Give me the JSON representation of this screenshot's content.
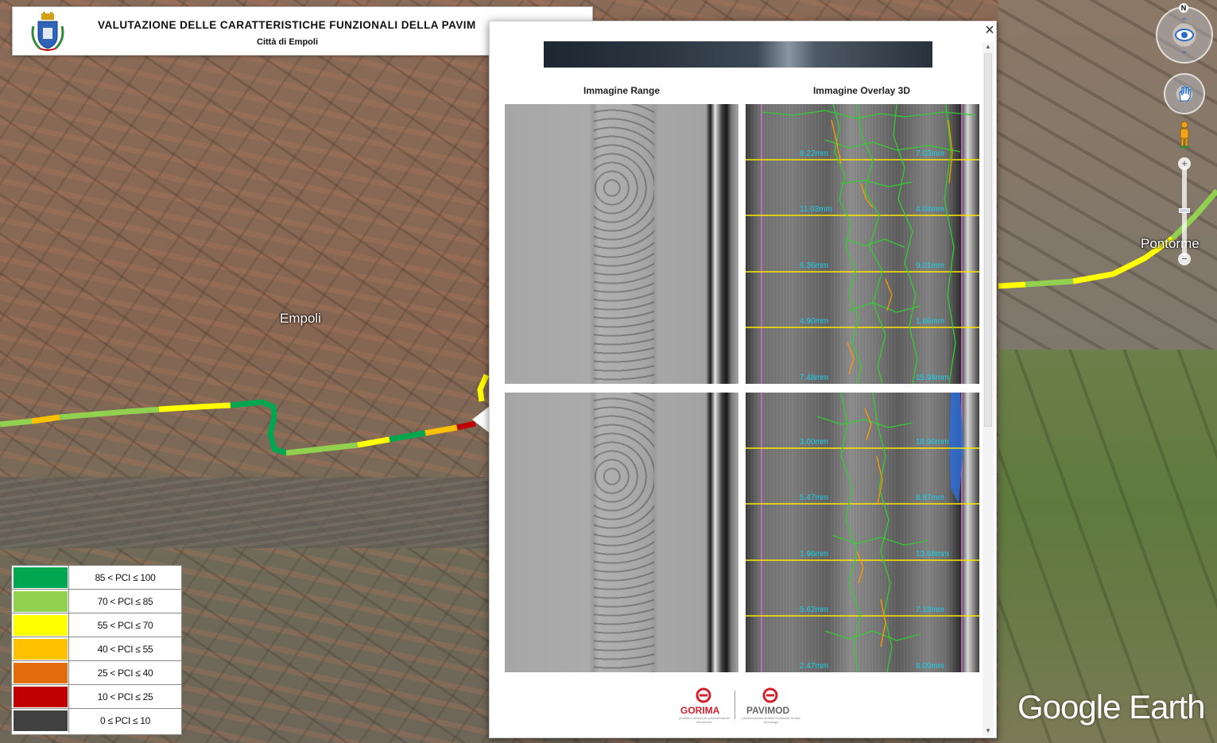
{
  "header": {
    "title": "VALUTAZIONE DELLE CARATTERISTICHE FUNZIONALI DELLA PAVIM",
    "subtitle": "Città di Empoli"
  },
  "map": {
    "labels": {
      "empoli": "Empoli",
      "pontorme": "Pontorme"
    },
    "compass_letter": "N",
    "watermark": "Google Earth"
  },
  "popup": {
    "close_label": "×",
    "column_range_title": "Immagine Range",
    "column_overlay_title": "Immagine Overlay 3D",
    "overlay_top": {
      "labels_left": [
        "8.22mm",
        "11.03mm",
        "6.36mm",
        "4.90mm",
        "7.48mm"
      ],
      "labels_right": [
        "7.03mm",
        "4.04mm",
        "9.01mm",
        "1.66mm",
        "15.98mm"
      ]
    },
    "overlay_bottom": {
      "labels_left": [
        "3.00mm",
        "5.47mm",
        "1.96mm",
        "5.62mm",
        "2.47mm"
      ],
      "labels_right": [
        "18.90mm",
        "8.87mm",
        "13.68mm",
        "7.18mm",
        "8.09mm"
      ]
    },
    "logos": {
      "gorima": "GORIMA",
      "gorima_tagline": "prodotti e servizi per pavimentazioni bituminose",
      "pavimod": "PAVIMOD",
      "pavimod_tagline": "pavimentazioni stradali modificate ad alta tecnologia"
    }
  },
  "legend": {
    "rows": [
      {
        "label": "85 < PCI ≤ 100",
        "color": "#00a650"
      },
      {
        "label": "70 < PCI ≤ 85",
        "color": "#92d050"
      },
      {
        "label": "55 < PCI ≤ 70",
        "color": "#ffff00"
      },
      {
        "label": "40 < PCI ≤ 55",
        "color": "#ffc000"
      },
      {
        "label": "25 < PCI ≤ 40",
        "color": "#e46c0a"
      },
      {
        "label": "10 < PCI ≤ 25",
        "color": "#c00000"
      },
      {
        "label": "0 ≤ PCI ≤ 10",
        "color": "#404040"
      }
    ]
  },
  "nav": {
    "zoom_in": "+",
    "zoom_out": "−"
  }
}
